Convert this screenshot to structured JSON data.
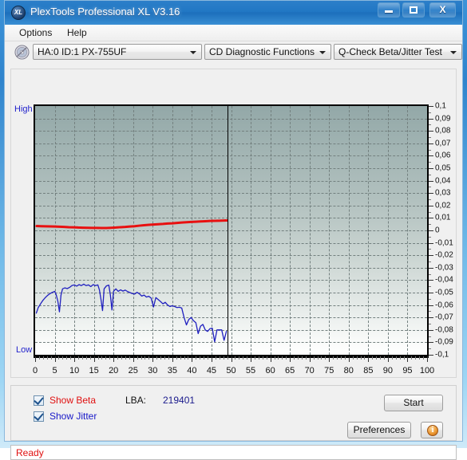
{
  "window": {
    "title": "PlexTools Professional XL V3.16",
    "app_icon": "XL",
    "minimize_label": "Minimize",
    "maximize_label": "Maximize",
    "close_label": "X"
  },
  "menubar": {
    "items": [
      {
        "label": "Options"
      },
      {
        "label": "Help"
      }
    ]
  },
  "toolbar": {
    "disc_icon": "disc-icon",
    "drive_combo": {
      "value": "HA:0 ID:1  PX-755UF"
    },
    "function_combo": {
      "value": "CD Diagnostic Functions"
    },
    "test_combo": {
      "value": "Q-Check Beta/Jitter Test"
    }
  },
  "controls": {
    "show_beta_label": "Show Beta",
    "show_beta_checked": true,
    "show_jitter_label": "Show Jitter",
    "show_jitter_checked": true,
    "lba_caption": "LBA:",
    "lba_value": "219401",
    "start_label": "Start",
    "preferences_label": "Preferences",
    "info_label": "i"
  },
  "statusbar": {
    "text": "Ready"
  },
  "colors": {
    "beta_line": "#e81010",
    "jitter_line": "#2020c0",
    "accent_blue": "#2177c4",
    "status_red": "#e01010",
    "plot_top": "#93a8a8",
    "plot_bottom": "#ffffff"
  },
  "chart_data": {
    "type": "line",
    "title": "Q-Check Beta/Jitter Test",
    "xlabel": "",
    "ylabel": "",
    "y_left_top_label": "High",
    "y_left_bottom_label": "Low",
    "xlim": [
      0,
      100
    ],
    "ylim": [
      -0.1,
      0.1
    ],
    "x_ticks": [
      0,
      5,
      10,
      15,
      20,
      25,
      30,
      35,
      40,
      45,
      50,
      55,
      60,
      65,
      70,
      75,
      80,
      85,
      90,
      95,
      100
    ],
    "x_tick_labels": [
      "0",
      "5",
      "10",
      "15",
      "20",
      "25",
      "30",
      "35",
      "40",
      "45",
      "50",
      "55",
      "60",
      "65",
      "70",
      "75",
      "80",
      "85",
      "90",
      "95",
      "100"
    ],
    "y_ticks": [
      0.1,
      0.09,
      0.08,
      0.07,
      0.06,
      0.05,
      0.04,
      0.03,
      0.02,
      0.01,
      0,
      -0.01,
      -0.02,
      -0.03,
      -0.04,
      -0.05,
      -0.06,
      -0.07,
      -0.08,
      -0.09,
      -0.1
    ],
    "y_tick_labels": [
      "0,1",
      "0,09",
      "0,08",
      "0,07",
      "0,06",
      "0,05",
      "0,04",
      "0,03",
      "0,02",
      "0,01",
      "0",
      "-0,01",
      "-0,02",
      "-0,03",
      "-0,04",
      "-0,05",
      "-0,06",
      "-0,07",
      "-0,08",
      "-0,09",
      "-0,1"
    ],
    "grid": true,
    "grid_style": "dashed",
    "legend_position": "bottom-left",
    "cursor_line_x": 49,
    "series": [
      {
        "name": "Beta",
        "color": "#e81010",
        "x": [
          0.4,
          1.5,
          2.6,
          3.8,
          5.0,
          6.2,
          7.4,
          8.6,
          9.8,
          11.0,
          12.2,
          13.4,
          14.6,
          15.8,
          17.0,
          18.2,
          19.4,
          20.6,
          21.8,
          23.0,
          24.2,
          25.4,
          26.6,
          27.8,
          29.0,
          30.2,
          31.4,
          32.6,
          33.8,
          35.0,
          36.2,
          37.4,
          38.6,
          39.8,
          41.0,
          42.2,
          43.4,
          44.6,
          45.8,
          47.0,
          48.2,
          48.9
        ],
        "values": [
          0.0035,
          0.0034,
          0.0033,
          0.0032,
          0.0031,
          0.003,
          0.0028,
          0.0026,
          0.0025,
          0.0023,
          0.0022,
          0.0021,
          0.002,
          0.002,
          0.0019,
          0.0019,
          0.0021,
          0.0023,
          0.0026,
          0.0028,
          0.0031,
          0.0034,
          0.0038,
          0.0042,
          0.0045,
          0.0047,
          0.005,
          0.0052,
          0.0055,
          0.0057,
          0.006,
          0.0063,
          0.0066,
          0.0068,
          0.007,
          0.0072,
          0.0074,
          0.0076,
          0.0077,
          0.0078,
          0.0079,
          0.008
        ]
      },
      {
        "name": "Jitter",
        "color": "#2020c0",
        "x": [
          0.3,
          0.8,
          1.4,
          2.0,
          2.6,
          3.2,
          3.8,
          4.4,
          5.0,
          5.4,
          5.8,
          6.2,
          6.6,
          7.0,
          7.6,
          8.2,
          8.8,
          9.4,
          10.0,
          10.6,
          11.2,
          11.8,
          12.4,
          13.0,
          13.6,
          14.2,
          14.8,
          15.4,
          16.0,
          16.4,
          16.8,
          17.2,
          17.6,
          18.2,
          18.8,
          19.2,
          19.6,
          20.0,
          20.6,
          21.2,
          21.8,
          22.4,
          23.0,
          23.6,
          24.2,
          24.8,
          25.4,
          26.0,
          26.6,
          27.2,
          27.8,
          28.4,
          29.0,
          29.6,
          30.2,
          30.8,
          31.4,
          32.0,
          32.6,
          33.2,
          33.8,
          34.4,
          35.0,
          35.6,
          36.2,
          36.8,
          37.4,
          38.0,
          38.6,
          39.2,
          39.8,
          40.4,
          41.0,
          41.6,
          42.2,
          42.8,
          43.4,
          44.0,
          44.6,
          45.2,
          45.8,
          46.4,
          47.0,
          47.6,
          48.2,
          48.8
        ],
        "values": [
          -0.0665,
          -0.062,
          -0.059,
          -0.0562,
          -0.054,
          -0.0522,
          -0.0508,
          -0.0498,
          -0.049,
          -0.052,
          -0.057,
          -0.0655,
          -0.052,
          -0.047,
          -0.0462,
          -0.0468,
          -0.0458,
          -0.0443,
          -0.0438,
          -0.0448,
          -0.0436,
          -0.0444,
          -0.0432,
          -0.0444,
          -0.0438,
          -0.0452,
          -0.0436,
          -0.0444,
          -0.0438,
          -0.0478,
          -0.0555,
          -0.0645,
          -0.047,
          -0.0446,
          -0.044,
          -0.052,
          -0.064,
          -0.049,
          -0.047,
          -0.049,
          -0.0478,
          -0.0488,
          -0.048,
          -0.0492,
          -0.05,
          -0.0508,
          -0.0512,
          -0.0498,
          -0.051,
          -0.0528,
          -0.052,
          -0.0536,
          -0.053,
          -0.0544,
          -0.0616,
          -0.054,
          -0.0556,
          -0.0572,
          -0.059,
          -0.0578,
          -0.06,
          -0.0612,
          -0.0606,
          -0.0612,
          -0.062,
          -0.0618,
          -0.0624,
          -0.07,
          -0.076,
          -0.0716,
          -0.07,
          -0.0726,
          -0.0742,
          -0.083,
          -0.077,
          -0.0756,
          -0.08,
          -0.0812,
          -0.079,
          -0.0786,
          -0.0896,
          -0.08,
          -0.08,
          -0.08,
          -0.0884,
          -0.0812
        ]
      }
    ]
  }
}
